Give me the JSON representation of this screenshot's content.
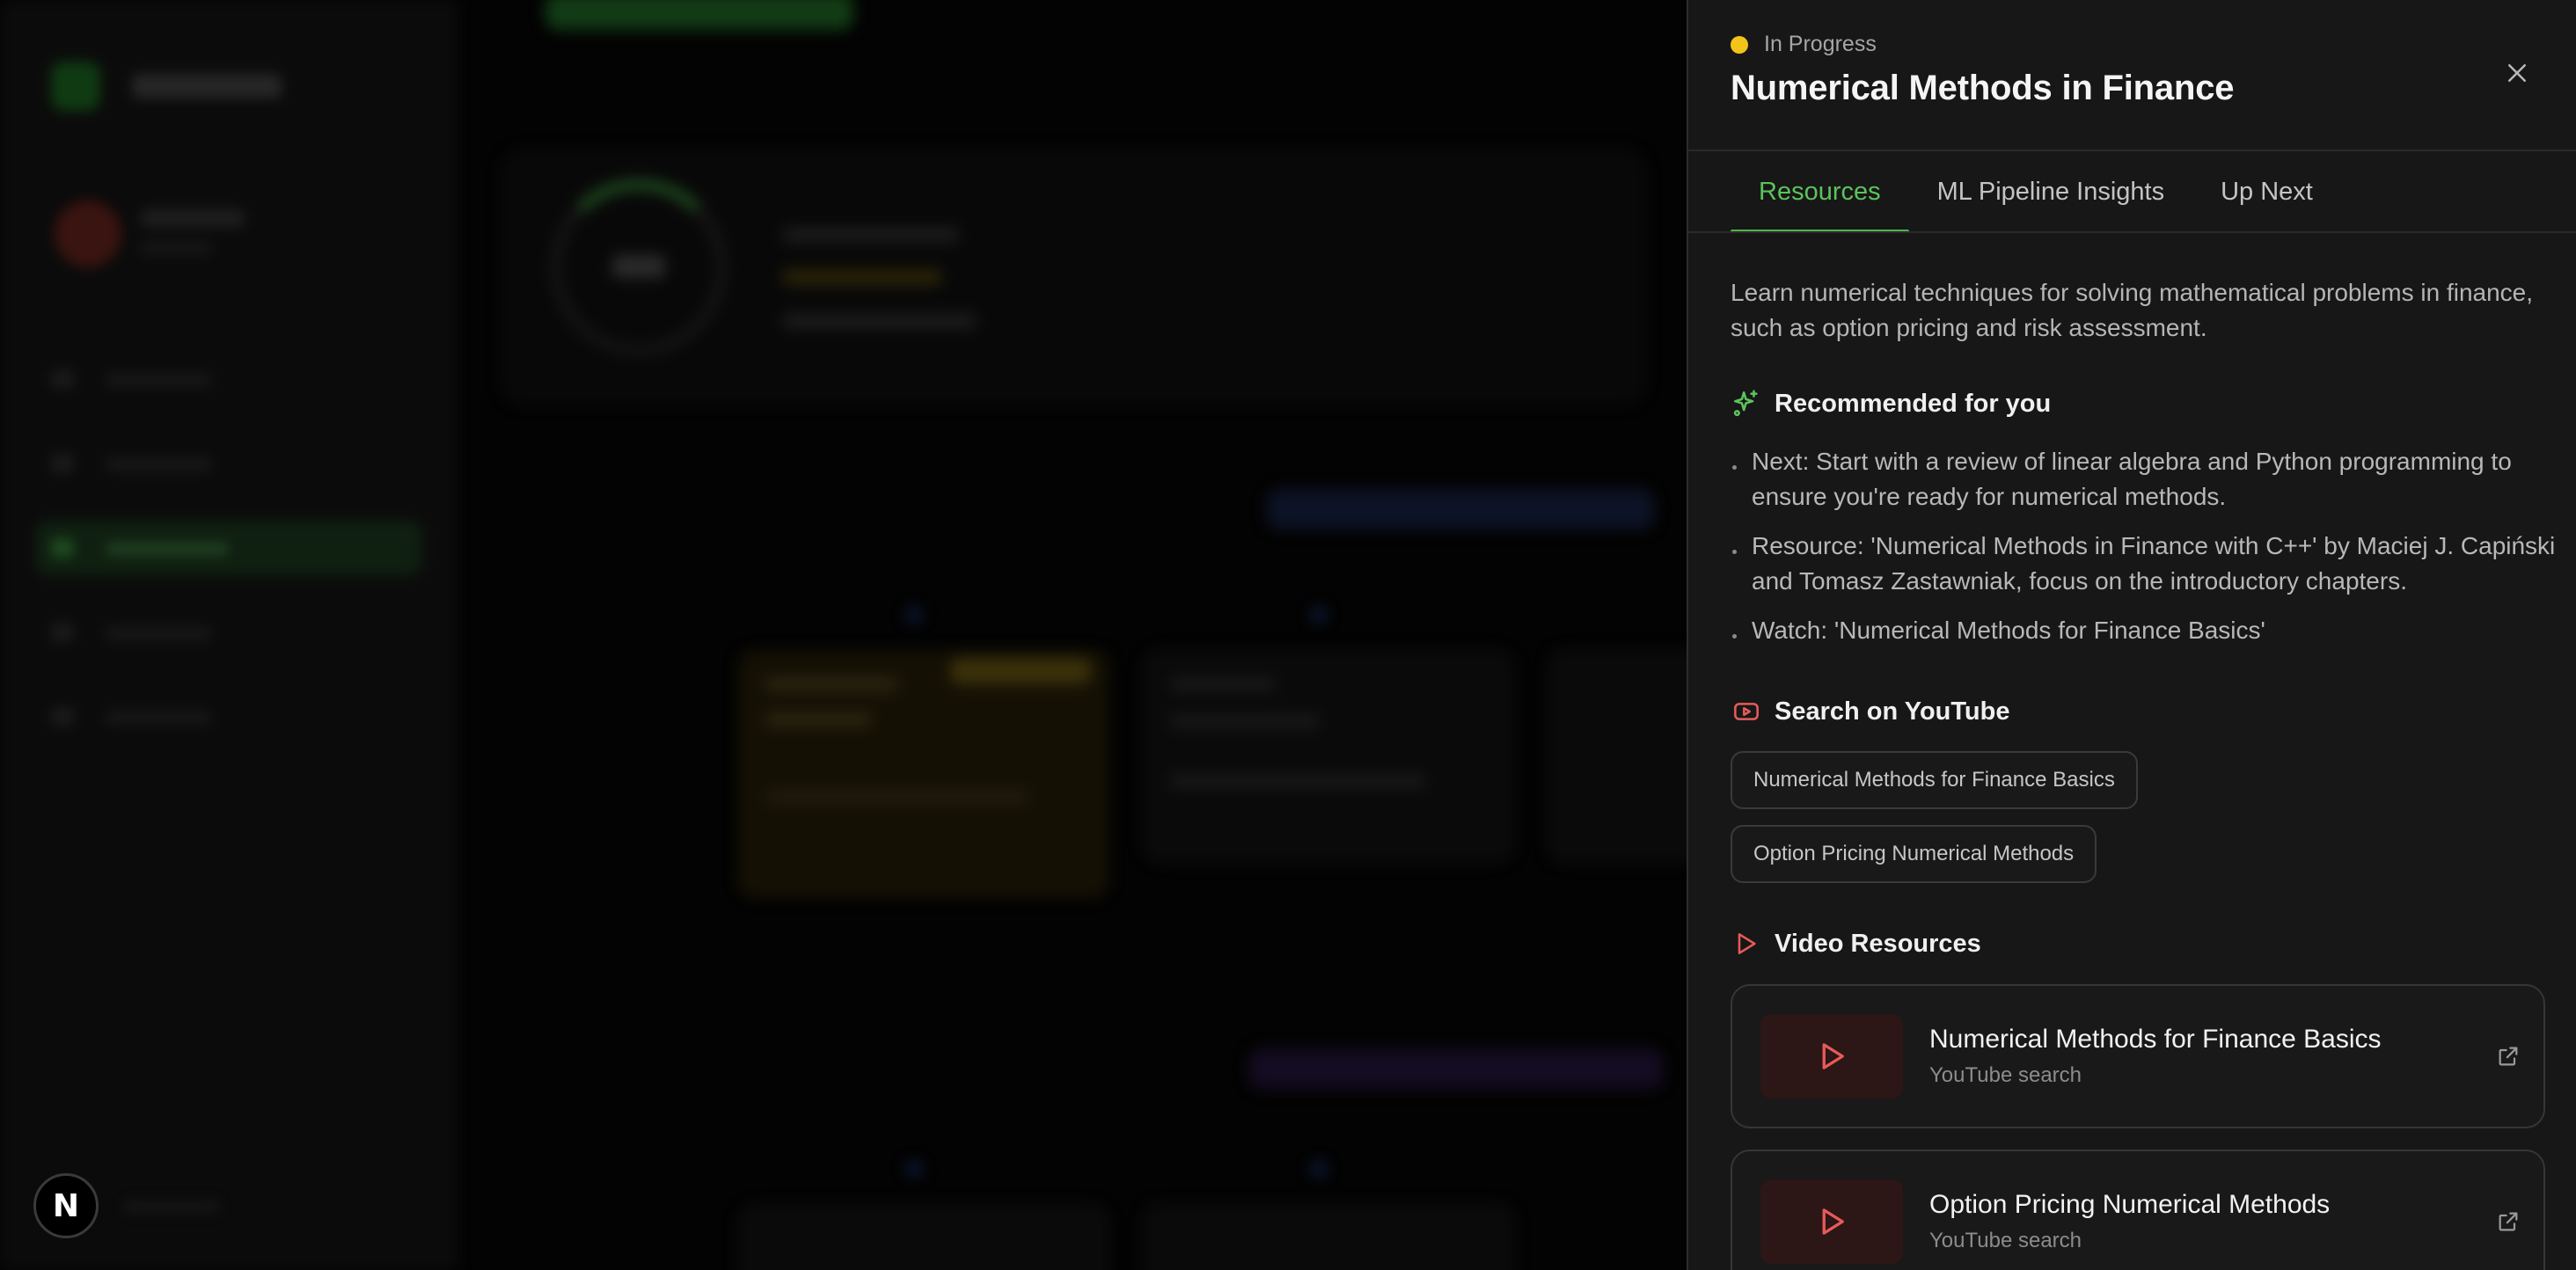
{
  "background_app": {
    "badge_letter": "N"
  },
  "drawer": {
    "status": "In Progress",
    "status_color": "#f2c417",
    "title": "Numerical Methods in Finance",
    "tabs": [
      {
        "label": "Resources",
        "active": true
      },
      {
        "label": "ML Pipeline Insights",
        "active": false
      },
      {
        "label": "Up Next",
        "active": false
      }
    ],
    "description": "Learn numerical techniques for solving mathematical problems in finance, such as option pricing and risk assessment.",
    "recommended": {
      "heading": "Recommended for you",
      "icon": "sparkles-icon",
      "items": [
        "Next: Start with a review of linear algebra and Python programming to ensure you're ready for numerical methods.",
        "Resource: 'Numerical Methods in Finance with C++' by Maciej J. Capiński and Tomasz Zastawniak, focus on the introductory chapters.",
        "Watch: 'Numerical Methods for Finance Basics'"
      ]
    },
    "youtube_search": {
      "heading": "Search on YouTube",
      "icon": "youtube-icon",
      "queries": [
        "Numerical Methods for Finance Basics",
        "Option Pricing Numerical Methods"
      ]
    },
    "video_resources": {
      "heading": "Video Resources",
      "icon": "play-icon",
      "videos": [
        {
          "title": "Numerical Methods for Finance Basics",
          "source": "YouTube search"
        },
        {
          "title": "Option Pricing Numerical Methods",
          "source": "YouTube search"
        }
      ]
    },
    "colors": {
      "accent_green": "#5cc35c",
      "youtube_red": "#e85a5a"
    }
  }
}
